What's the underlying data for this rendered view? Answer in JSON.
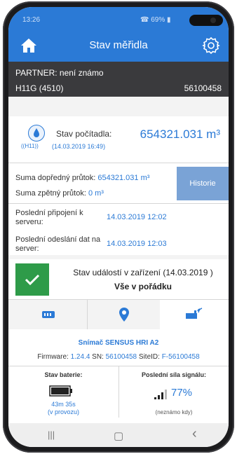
{
  "status_bar": {
    "time": "13:26",
    "right": "☎ 69% ▮"
  },
  "app": {
    "title": "Stav měřidla"
  },
  "partner": {
    "line1": "PARTNER: není známo",
    "meter": "H11G (4510)",
    "serial": "56100458"
  },
  "counter": {
    "label": "Stav počítadla:",
    "date": "(14.03.2019 16:49)",
    "value": "654321.031 m³",
    "badge": "H11"
  },
  "flow": {
    "forward_label": "Suma dopředný průtok:",
    "forward_value": "654321.031 m³",
    "backward_label": "Suma zpětný průtok:",
    "backward_value": "0 m³",
    "history_button": "Historie"
  },
  "connection": {
    "last_connect_label": "Poslední připojení k serveru:",
    "last_connect_value": "14.03.2019 12:02",
    "last_send_label": "Poslední odeslání dat na server:",
    "last_send_value": "14.03.2019 12:03"
  },
  "events": {
    "title": "Stav událostí v zařízení (14.03.2019 )",
    "status": "Vše v pořádku",
    "status_color": "#2e9b49"
  },
  "tabs": [
    {
      "icon": "meter-icon"
    },
    {
      "icon": "location-pin-icon"
    },
    {
      "icon": "radio-transmitter-icon",
      "selected": true
    }
  ],
  "sensor": {
    "name": "Snímač SENSUS HRI A2",
    "firmware_label": "Firmware:",
    "firmware": "1.24.4",
    "sn_label": "SN:",
    "sn": "56100458",
    "siteid_label": "SiteID:",
    "siteid": "F-56100458"
  },
  "battery": {
    "title": "Stav baterie:",
    "value": "43m 35s",
    "note": "(v provozu)"
  },
  "signal": {
    "title": "Poslední síla signálu:",
    "value": "77%",
    "when": "(neznámo kdy)"
  },
  "navbar": {
    "recents": "|||",
    "home": "▢",
    "back": "‹"
  },
  "colors": {
    "accent": "#2b7ad6",
    "header_dark": "#3a3a3d",
    "ok_green": "#2e9b49",
    "history_button": "#7aa3d6"
  }
}
